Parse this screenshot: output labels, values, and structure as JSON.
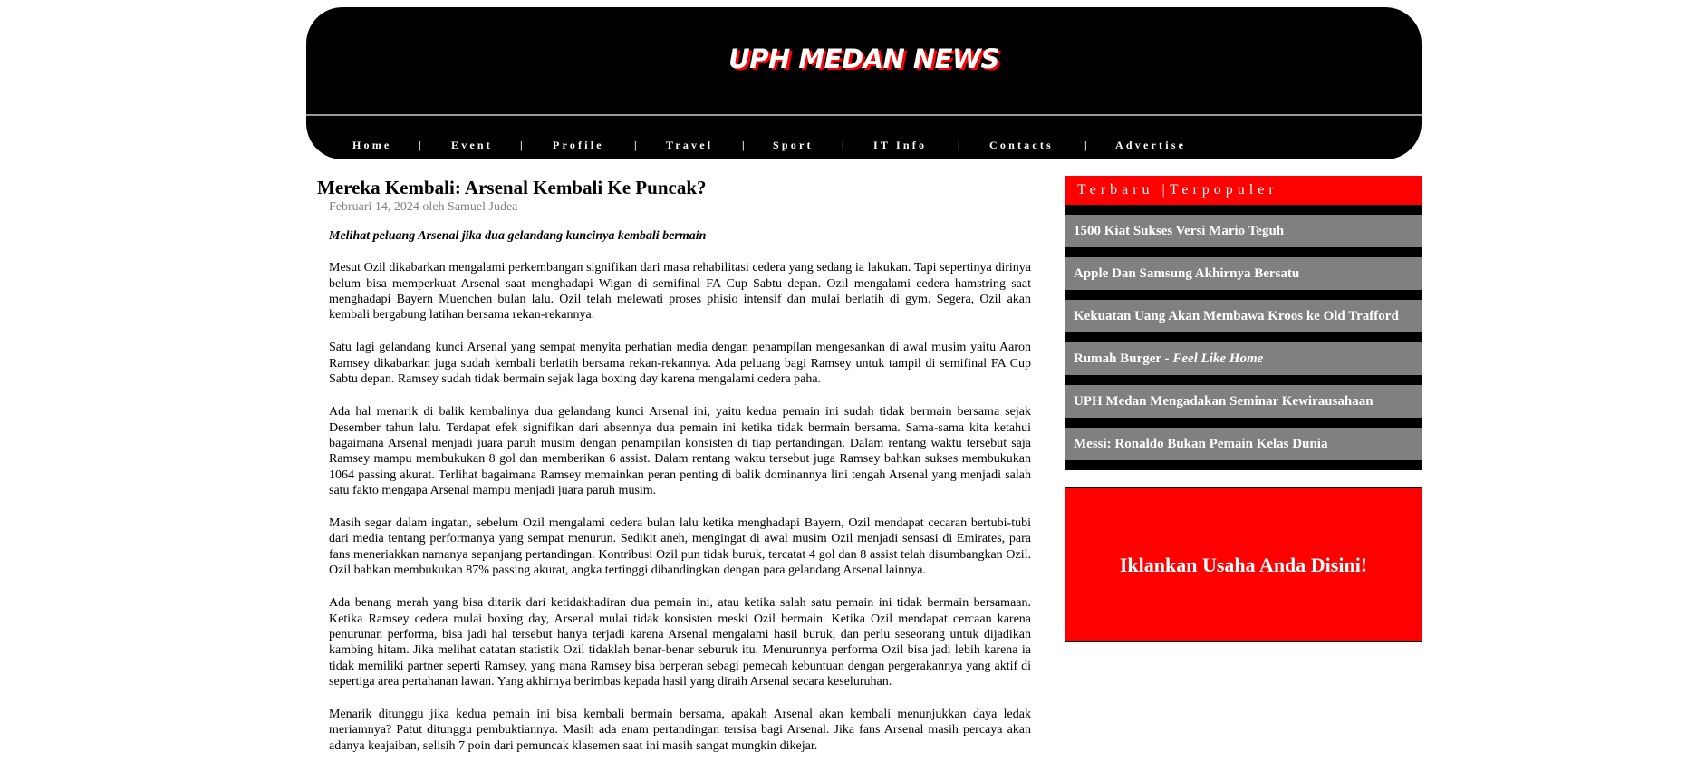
{
  "site": {
    "title": "UPH MEDAN NEWS"
  },
  "nav": {
    "items": [
      "Home",
      "Event",
      "Profile",
      "Travel",
      "Sport",
      "IT Info",
      "Contacts",
      "Advertise"
    ],
    "separator": "|"
  },
  "article": {
    "title": "Mereka Kembali: Arsenal Kembali Ke Puncak?",
    "byline": "Februari 14, 2024 oleh Samuel Judea",
    "lead": "Melihat peluang Arsenal jika dua gelandang kuncinya kembali bermain",
    "paragraphs": [
      "Mesut Ozil dikabarkan mengalami perkembangan signifikan dari masa rehabilitasi cedera yang sedang ia lakukan. Tapi sepertinya dirinya belum bisa memperkuat Arsenal saat menghadapi Wigan di semifinal FA Cup Sabtu depan. Ozil mengalami cedera hamstring saat menghadapi Bayern Muenchen bulan lalu. Ozil telah melewati proses phisio intensif dan mulai berlatih di gym. Segera, Ozil akan kembali bergabung latihan bersama rekan-rekannya.",
      "Satu lagi gelandang kunci Arsenal yang sempat menyita perhatian media dengan penampilan mengesankan di awal musim yaitu Aaron Ramsey dikabarkan juga sudah kembali berlatih bersama rekan-rekannya. Ada peluang bagi Ramsey untuk tampil di semifinal FA Cup Sabtu depan. Ramsey sudah tidak bermain sejak laga boxing day karena mengalami cedera paha.",
      "Ada hal menarik di balik kembalinya dua gelandang kunci Arsenal ini, yaitu kedua pemain ini sudah tidak bermain bersama sejak Desember tahun lalu. Terdapat efek signifikan dari absennya dua pemain ini ketika tidak bermain bersama. Sama-sama kita ketahui bagaimana Arsenal menjadi juara paruh musim dengan penampilan konsisten di tiap pertandingan. Dalam rentang waktu tersebut saja Ramsey mampu membukukan 8 gol dan memberikan 6 assist. Dalam rentang waktu tersebut juga Ramsey bahkan sukses membukukan 1064 passing akurat. Terlihat bagaimana Ramsey memainkan peran penting di balik dominannya lini tengah Arsenal yang menjadi salah satu fakto mengapa Arsenal mampu menjadi juara paruh musim.",
      "Masih segar dalam ingatan, sebelum Ozil mengalami cedera bulan lalu ketika menghadapi Bayern, Ozil mendapat cecaran bertubi-tubi dari media tentang performanya yang sempat menurun. Sedikit aneh, mengingat di awal musim Ozil menjadi sensasi di Emirates, para fans meneriakkan namanya sepanjang pertandingan. Kontribusi Ozil pun tidak buruk, tercatat 4 gol dan 8 assist telah disumbangkan Ozil. Ozil bahkan membukukan 87% passing akurat, angka tertinggi dibandingkan dengan para gelandang Arsenal lainnya.",
      "Ada benang merah yang bisa ditarik dari ketidakhadiran dua pemain ini, atau ketika salah satu pemain ini tidak bermain bersamaan. Ketika Ramsey cedera mulai boxing day, Arsenal mulai tidak konsisten meski Ozil bermain. Ketika Ozil mendapat cercaan karena penurunan performa, bisa jadi hal tersebut hanya terjadi karena Arsenal mengalami hasil buruk, dan perlu seseorang untuk dijadikan kambing hitam. Jika melihat catatan statistik Ozil tidaklah benar-benar seburuk itu. Menurunnya performa Ozil bisa jadi lebih karena ia tidak memiliki partner seperti Ramsey, yang mana Ramsey bisa berperan sebagi pemecah kebuntuan dengan pergerakannya yang aktif di sepertiga area pertahanan lawan. Yang akhirnya berimbas kepada hasil yang diraih Arsenal secara keseluruhan.",
      "Menarik ditunggu jika kedua pemain ini bisa kembali bermain bersama, apakah Arsenal akan kembali menunjukkan daya ledak meriamnya? Patut ditunggu pembuktiannya. Masih ada enam pertandingan tersisa bagi Arsenal. Jika fans Arsenal masih percaya akan adanya keajaiban, selisih 7 poin dari pemuncak klasemen saat ini masih sangat mungkin dikejar."
    ]
  },
  "sidebar": {
    "tab_latest": "Terbaru",
    "tab_separator": "|",
    "tab_popular": "Terpopuler",
    "news": [
      {
        "title": "1500 Kiat Sukses Versi Mario Teguh",
        "suffix": ""
      },
      {
        "title": "Apple Dan Samsung Akhirnya Bersatu",
        "suffix": ""
      },
      {
        "title": "Kekuatan Uang Akan Membawa Kroos ke Old Trafford",
        "suffix": ""
      },
      {
        "title": "Rumah Burger - ",
        "suffix": "Feel Like Home"
      },
      {
        "title": "UPH Medan Mengadakan Seminar Kewirausahaan",
        "suffix": ""
      },
      {
        "title": "Messi: Ronaldo Bukan Pemain Kelas Dunia",
        "suffix": ""
      }
    ],
    "ad_text": "Iklankan Usaha Anda Disini!"
  },
  "colors": {
    "header_bg": "#000000",
    "accent_red": "#ff0000",
    "news_item_bg": "#808080",
    "byline": "#808080"
  }
}
